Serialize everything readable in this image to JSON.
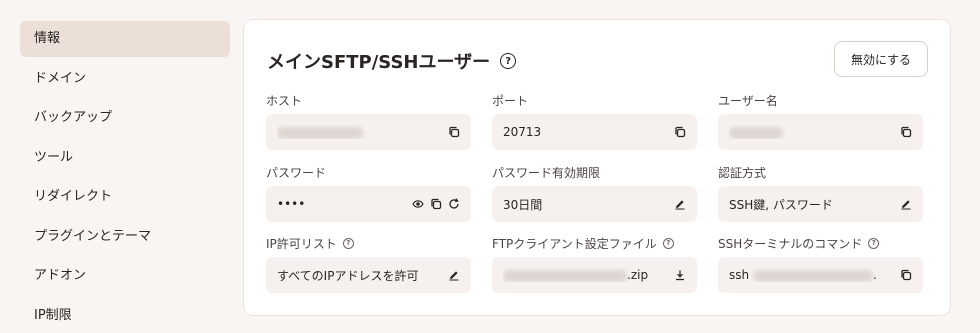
{
  "sidebar": {
    "items": [
      {
        "label": "情報",
        "active": true
      },
      {
        "label": "ドメイン"
      },
      {
        "label": "バックアップ"
      },
      {
        "label": "ツール"
      },
      {
        "label": "リダイレクト"
      },
      {
        "label": "プラグインとテーマ"
      },
      {
        "label": "アドオン"
      },
      {
        "label": "IP制限"
      }
    ]
  },
  "card": {
    "title": "メインSFTP/SSHユーザー",
    "help_icon": "question-circle-icon",
    "disable_button": "無効にする"
  },
  "fields": {
    "host": {
      "label": "ホスト",
      "value": ""
    },
    "port": {
      "label": "ポート",
      "value": "20713"
    },
    "username": {
      "label": "ユーザー名",
      "value": ""
    },
    "password": {
      "label": "パスワード",
      "value": "••••"
    },
    "password_expiry": {
      "label": "パスワード有効期限",
      "value": "30日間"
    },
    "auth_method": {
      "label": "認証方式",
      "value": "SSH鍵, パスワード"
    },
    "ip_allowlist": {
      "label": "IP許可リスト",
      "value": "すべてのIPアドレスを許可"
    },
    "ftp_config": {
      "label": "FTPクライアント設定ファイル",
      "value_suffix": ".zip"
    },
    "ssh_command": {
      "label": "SSHターミナルのコマンド",
      "value_prefix": "ssh",
      "value_suffix": "."
    }
  },
  "colors": {
    "background": "#f9f5f3",
    "active_nav": "#ecdfd8",
    "field_bg": "#f6f1ee",
    "text": "#2a2422"
  }
}
